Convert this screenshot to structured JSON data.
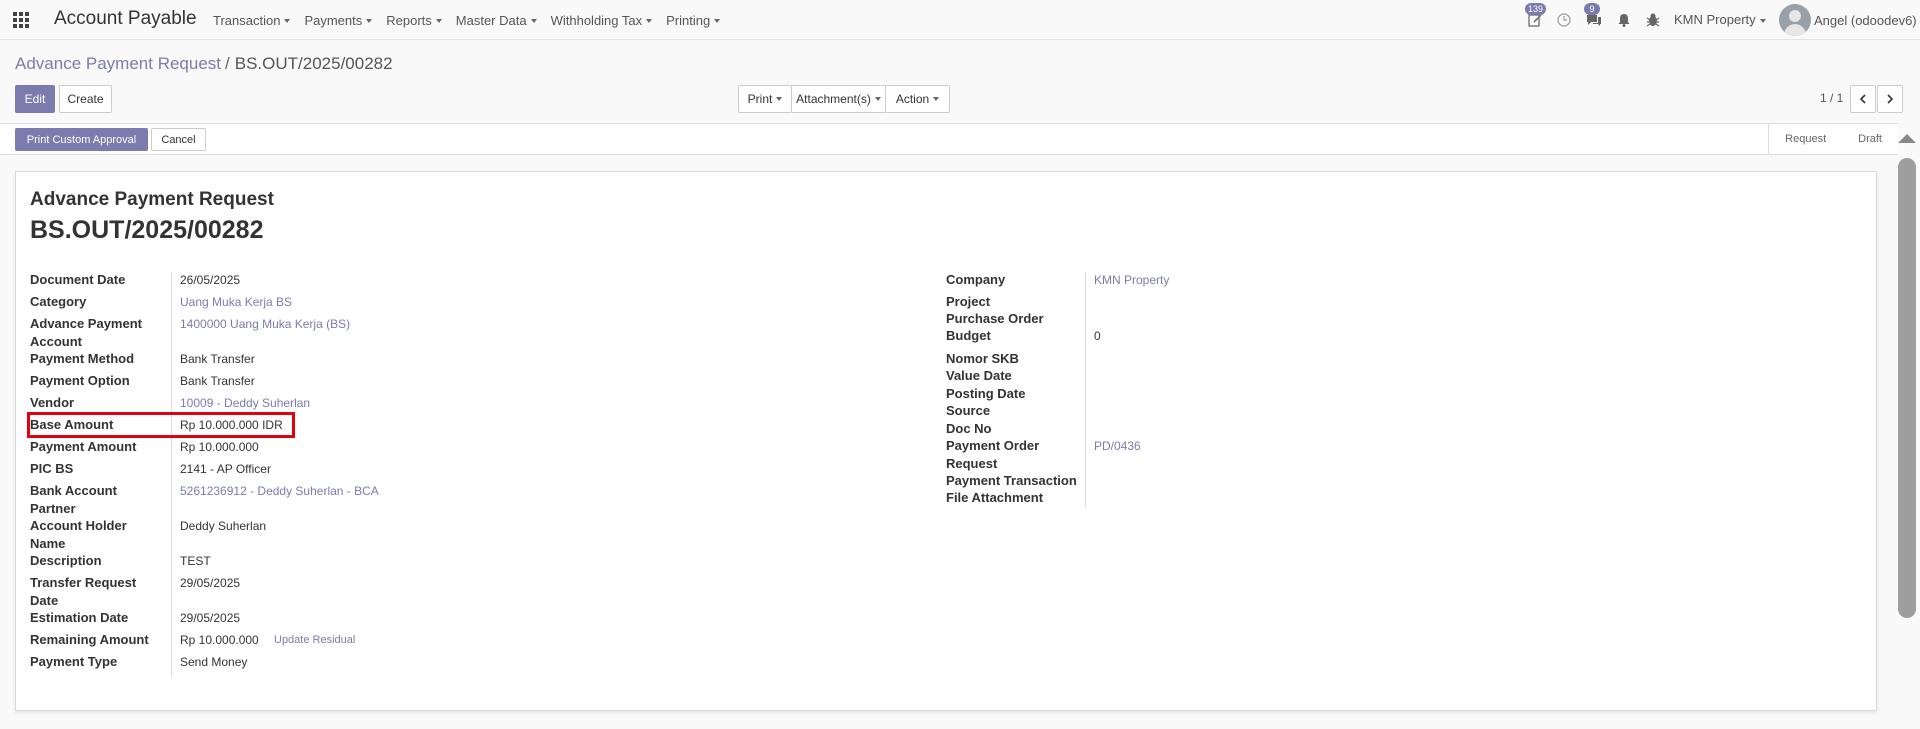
{
  "navbar": {
    "brand": "Account Payable",
    "menu": [
      "Transaction",
      "Payments",
      "Reports",
      "Master Data",
      "Withholding Tax",
      "Printing"
    ],
    "activity_badge": "139",
    "messages_badge": "9",
    "company": "KMN Property",
    "user": "Angel (odoodev6)"
  },
  "breadcrumb": {
    "parent": "Advance Payment Request",
    "separator": "/",
    "current": "BS.OUT/2025/00282"
  },
  "buttons": {
    "edit": "Edit",
    "create": "Create",
    "print": "Print",
    "attachments": "Attachment(s)",
    "action": "Action",
    "print_custom": "Print Custom Approval",
    "cancel": "Cancel"
  },
  "pager": "1 / 1",
  "status": [
    "Request",
    "Draft"
  ],
  "sheet": {
    "title": "Advance Payment Request",
    "name": "BS.OUT/2025/00282",
    "left": [
      {
        "label": "Document Date",
        "value": "26/05/2025"
      },
      {
        "label": "Category",
        "value": "Uang Muka Kerja BS"
      },
      {
        "label": "Advance Payment Account",
        "value": "1400000 Uang Muka Kerja (BS)"
      },
      {
        "label": "Payment Method",
        "value": "Bank Transfer"
      },
      {
        "label": "Payment Option",
        "value": "Bank Transfer"
      },
      {
        "label": "Vendor",
        "value": "10009 - Deddy Suherlan"
      },
      {
        "label": "Base Amount",
        "value": "Rp 10.000.000 IDR"
      },
      {
        "label": "Payment Amount",
        "value": "Rp 10.000.000"
      },
      {
        "label": "PIC BS",
        "value": "2141 - AP Officer"
      },
      {
        "label": "Bank Account Partner",
        "value": "5261236912 - Deddy Suherlan - BCA"
      },
      {
        "label": "Account Holder Name",
        "value": "Deddy Suherlan"
      },
      {
        "label": "Description",
        "value": "TEST"
      },
      {
        "label": "Transfer Request Date",
        "value": "29/05/2025"
      },
      {
        "label": "Estimation Date",
        "value": "29/05/2025"
      },
      {
        "label": "Remaining Amount",
        "value": "Rp 10.000.000"
      },
      {
        "label": "Payment Type",
        "value": "Send Money"
      }
    ],
    "update_residual": "Update Residual",
    "right": [
      {
        "label": "Company",
        "value": "KMN Property"
      },
      {
        "label": "Project",
        "value": ""
      },
      {
        "label": "Purchase Order",
        "value": ""
      },
      {
        "label": "Budget",
        "value": "0"
      },
      {
        "label": "Nomor SKB",
        "value": ""
      },
      {
        "label": "Value Date",
        "value": ""
      },
      {
        "label": "Posting Date",
        "value": ""
      },
      {
        "label": "Source",
        "value": ""
      },
      {
        "label": "Doc No",
        "value": ""
      },
      {
        "label": "Payment Order Request",
        "value": "PD/0436"
      },
      {
        "label": "Payment Transaction",
        "value": ""
      },
      {
        "label": "File Attachment",
        "value": ""
      }
    ]
  }
}
